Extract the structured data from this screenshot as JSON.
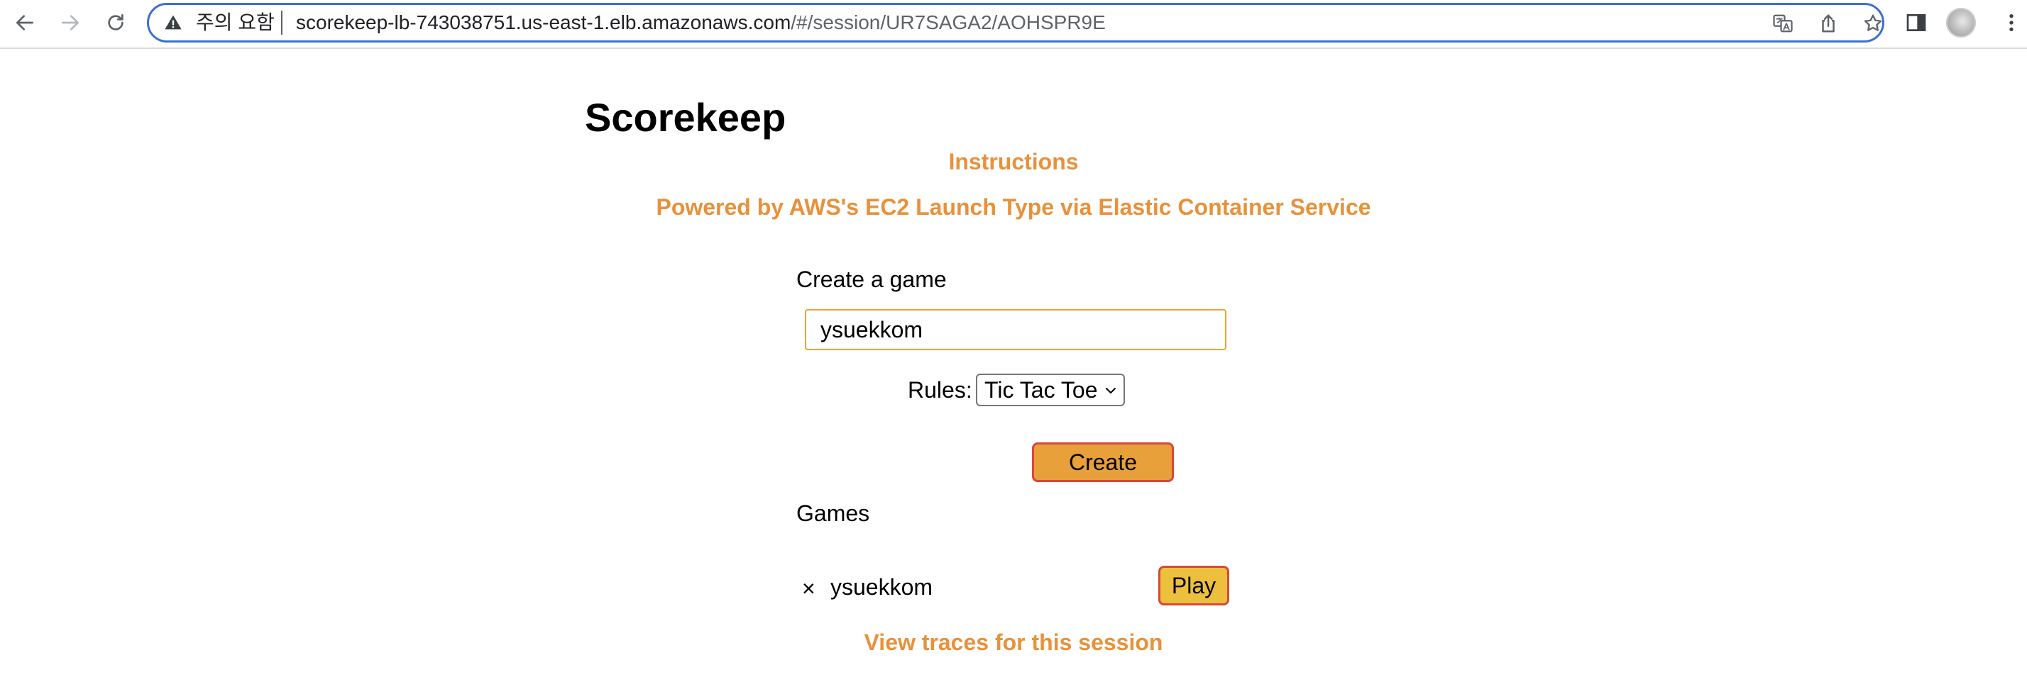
{
  "browser": {
    "security_label": "주의 요함",
    "url_host": "scorekeep-lb-743038751.us-east-1.elb.amazonaws.com",
    "url_path": "/#/session/UR7SAGA2/AOHSPR9E",
    "icons": {
      "back": "arrow-left-icon",
      "forward": "arrow-right-icon",
      "reload": "reload-icon",
      "warning": "warning-icon",
      "translate": "translate-icon",
      "share": "share-icon",
      "bookmark": "star-icon",
      "side_panel": "side-panel-icon",
      "profile": "avatar"
    }
  },
  "page": {
    "title": "Scorekeep",
    "instructions_link": "Instructions",
    "powered_by_link": "Powered by AWS's EC2 Launch Type via Elastic Container Service",
    "create_game_label": "Create a game",
    "game_name_value": "ysuekkom",
    "rules_label": "Rules:",
    "rules_selected": "Tic Tac Toe",
    "create_button": "Create",
    "games_heading": "Games",
    "games": [
      {
        "delete_symbol": "×",
        "name": "ysuekkom",
        "play_button": "Play"
      }
    ],
    "traces_link": "View traces for this session"
  },
  "colors": {
    "link_orange": "#e8913a",
    "button_orange": "#e8a03a",
    "button_yellow": "#ecbf3c",
    "button_border": "#d9473a",
    "omnibox_border": "#3b6fd4"
  }
}
